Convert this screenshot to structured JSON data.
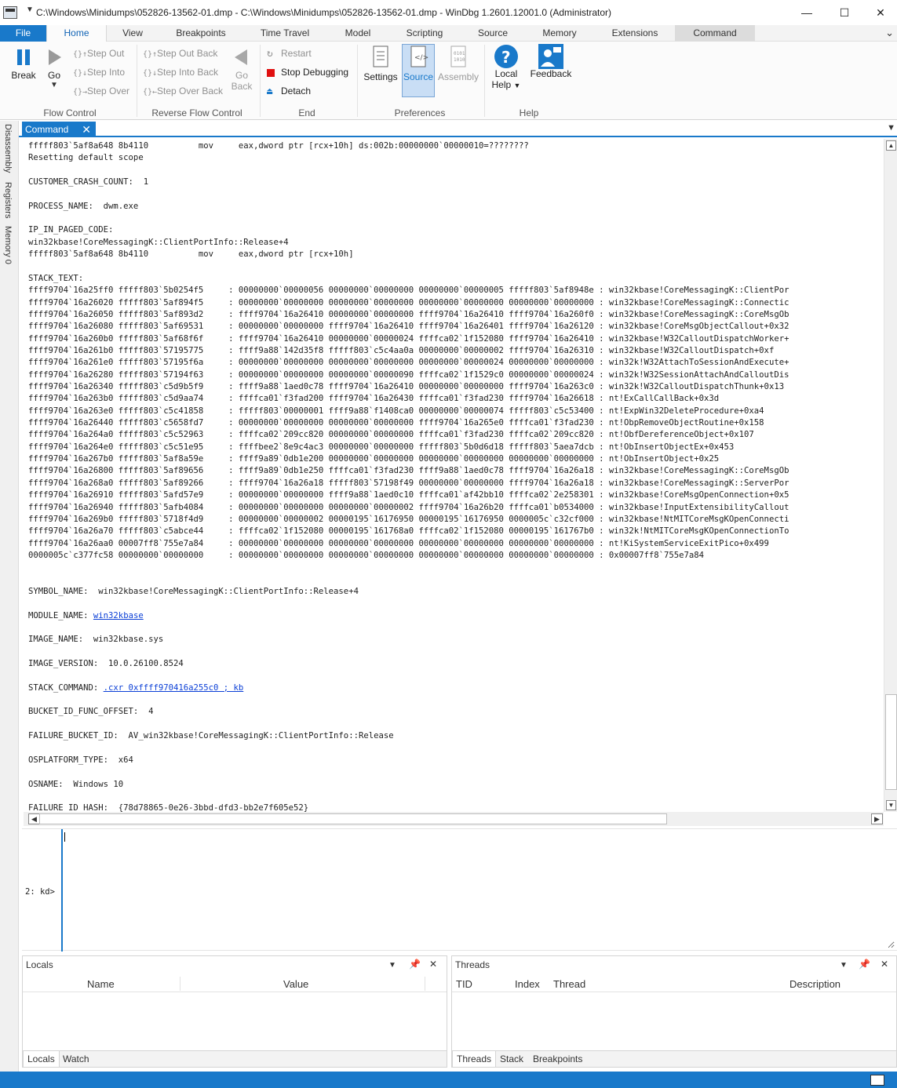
{
  "window": {
    "title": "C:\\Windows\\Minidumps\\052826-13562-01.dmp - C:\\Windows\\Minidumps\\052826-13562-01.dmp - WinDbg 1.2601.12001.0 (Administrator)",
    "minimize": "—",
    "maximize": "☐",
    "close": "✕"
  },
  "tabs": {
    "file": "File",
    "home": "Home",
    "view": "View",
    "breakpoints": "Breakpoints",
    "time_travel": "Time Travel",
    "model": "Model",
    "scripting": "Scripting",
    "source": "Source",
    "memory": "Memory",
    "extensions": "Extensions",
    "command": "Command"
  },
  "ribbon": {
    "flow_control": {
      "label": "Flow Control",
      "break": "Break",
      "go": "Go",
      "step_out": "Step Out",
      "step_into": "Step Into",
      "step_over": "Step Over"
    },
    "reverse_flow_control": {
      "label": "Reverse Flow Control",
      "step_out_back": "Step Out Back",
      "step_into_back": "Step Into Back",
      "step_over_back": "Step Over Back",
      "go_back_1": "Go",
      "go_back_2": "Back"
    },
    "end": {
      "label": "End",
      "restart": "Restart",
      "stop_debugging": "Stop Debugging",
      "detach": "Detach"
    },
    "preferences": {
      "label": "Preferences",
      "settings": "Settings",
      "source": "Source",
      "assembly": "Assembly"
    },
    "help": {
      "label": "Help",
      "local_help_1": "Local",
      "local_help_2": "Help",
      "feedback": "Feedback"
    }
  },
  "side_tabs": [
    "Disassembly",
    "Registers",
    "Memory 0"
  ],
  "command_window": {
    "tab_label": "Command",
    "lines": [
      "fffff803`5af8a648 8b4110          mov     eax,dword ptr [rcx+10h] ds:002b:00000000`00000010=????????",
      "Resetting default scope",
      "",
      "CUSTOMER_CRASH_COUNT:  1",
      "",
      "PROCESS_NAME:  dwm.exe",
      "",
      "IP_IN_PAGED_CODE:",
      "win32kbase!CoreMessagingK::ClientPortInfo::Release+4",
      "fffff803`5af8a648 8b4110          mov     eax,dword ptr [rcx+10h]",
      "",
      "STACK_TEXT:",
      "ffff9704`16a25ff0 fffff803`5b0254f5     : 00000000`00000056 00000000`00000000 00000000`00000005 fffff803`5af8948e : win32kbase!CoreMessagingK::ClientPor",
      "ffff9704`16a26020 fffff803`5af894f5     : 00000000`00000000 00000000`00000000 00000000`00000000 00000000`00000000 : win32kbase!CoreMessagingK::Connectic",
      "ffff9704`16a26050 fffff803`5af893d2     : ffff9704`16a26410 00000000`00000000 ffff9704`16a26410 ffff9704`16a260f0 : win32kbase!CoreMessagingK::CoreMsgOb",
      "ffff9704`16a26080 fffff803`5af69531     : 00000000`00000000 ffff9704`16a26410 ffff9704`16a26401 ffff9704`16a26120 : win32kbase!CoreMsgObjectCallout+0x32",
      "ffff9704`16a260b0 fffff803`5af68f6f     : ffff9704`16a26410 00000000`00000024 ffffca02`1f152080 ffff9704`16a26410 : win32kbase!W32CalloutDispatchWorker+",
      "ffff9704`16a261b0 fffff803`57195775     : ffff9a88`142d35f8 fffff803`c5c4aa0a 00000000`00000002 ffff9704`16a26310 : win32kbase!W32CalloutDispatch+0xf",
      "ffff9704`16a261e0 fffff803`57195f6a     : 00000000`00000000 00000000`00000000 00000000`00000024 00000000`00000000 : win32k!W32AttachToSessionAndExecute+",
      "ffff9704`16a26280 fffff803`57194f63     : 00000000`00000000 00000000`00000090 ffffca02`1f1529c0 00000000`00000024 : win32k!W32SessionAttachAndCalloutDis",
      "ffff9704`16a26340 fffff803`c5d9b5f9     : ffff9a88`1aed0c78 ffff9704`16a26410 00000000`00000000 ffff9704`16a263c0 : win32k!W32CalloutDispatchThunk+0x13",
      "ffff9704`16a263b0 fffff803`c5d9aa74     : ffffca01`f3fad200 ffff9704`16a26430 ffffca01`f3fad230 ffff9704`16a26618 : nt!ExCallCallBack+0x3d",
      "ffff9704`16a263e0 fffff803`c5c41858     : fffff803`00000001 ffff9a88`f1408ca0 00000000`00000074 fffff803`c5c53400 : nt!ExpWin32DeleteProcedure+0xa4",
      "ffff9704`16a26440 fffff803`c5658fd7     : 00000000`00000000 00000000`00000000 ffff9704`16a265e0 ffffca01`f3fad230 : nt!ObpRemoveObjectRoutine+0x158",
      "ffff9704`16a264a0 fffff803`c5c52963     : ffffca02`209cc820 00000000`00000000 ffffca01`f3fad230 ffffca02`209cc820 : nt!ObfDereferenceObject+0x107",
      "ffff9704`16a264e0 fffff803`c5c51e95     : ffffbee2`8e9c4ac3 00000000`00000000 fffff803`5b0d6d18 fffff803`5aea7dcb : nt!ObInsertObjectEx+0x453",
      "ffff9704`16a267b0 fffff803`5af8a59e     : ffff9a89`0db1e200 00000000`00000000 00000000`00000000 00000000`00000000 : nt!ObInsertObject+0x25",
      "ffff9704`16a26800 fffff803`5af89656     : ffff9a89`0db1e250 ffffca01`f3fad230 ffff9a88`1aed0c78 ffff9704`16a26a18 : win32kbase!CoreMessagingK::CoreMsgOb",
      "ffff9704`16a268a0 fffff803`5af89266     : ffff9704`16a26a18 fffff803`57198f49 00000000`00000000 ffff9704`16a26a18 : win32kbase!CoreMessagingK::ServerPor",
      "ffff9704`16a26910 fffff803`5afd57e9     : 00000000`00000000 ffff9a88`1aed0c10 ffffca01`af42bb10 ffffca02`2e258301 : win32kbase!CoreMsgOpenConnection+0x5",
      "ffff9704`16a26940 fffff803`5afb4084     : 00000000`00000000 00000000`00000002 ffff9704`16a26b20 ffffca01`b0534000 : win32kbase!InputExtensibilityCallout",
      "ffff9704`16a269b0 fffff803`5718f4d9     : 00000000`00000002 00000195`16176950 00000195`16176950 0000005c`c32cf000 : win32kbase!NtMITCoreMsgKOpenConnecti",
      "ffff9704`16a26a70 fffff803`c5abce44     : ffffca02`1f152080 00000195`161768a0 ffffca02`1f152080 00000195`161767b0 : win32k!NtMITCoreMsgKOpenConnectionTo",
      "ffff9704`16a26aa0 00007ff8`755e7a84     : 00000000`00000000 00000000`00000000 00000000`00000000 00000000`00000000 : nt!KiSystemServiceExitPico+0x499",
      "0000005c`c377fc58 00000000`00000000     : 00000000`00000000 00000000`00000000 00000000`00000000 00000000`00000000 : 0x00007ff8`755e7a84",
      "",
      "",
      "SYMBOL_NAME:  win32kbase!CoreMessagingK::ClientPortInfo::Release+4",
      ""
    ],
    "module_label": "MODULE_NAME: ",
    "module_link": "win32kbase",
    "after_module": [
      "",
      "IMAGE_NAME:  win32kbase.sys",
      "",
      "IMAGE_VERSION:  10.0.26100.8524",
      ""
    ],
    "stack_command_label": "STACK_COMMAND: ",
    "stack_command_link": ".cxr 0xffff970416a255c0 ; kb",
    "after_stack_command": [
      "",
      "BUCKET_ID_FUNC_OFFSET:  4",
      "",
      "FAILURE_BUCKET_ID:  AV_win32kbase!CoreMessagingK::ClientPortInfo::Release",
      "",
      "OSPLATFORM_TYPE:  x64",
      "",
      "OSNAME:  Windows 10",
      "",
      "FAILURE_ID_HASH:  {78d78865-0e26-3bbd-dfd3-bb2e7f605e52}"
    ],
    "prompt": "2: kd>",
    "input_value": ""
  },
  "locals_pane": {
    "title": "Locals",
    "columns": [
      "Name",
      "Value"
    ],
    "tabs": [
      "Locals",
      "Watch"
    ]
  },
  "threads_pane": {
    "title": "Threads",
    "columns": [
      "TID",
      "Index",
      "Thread",
      "Description"
    ],
    "tabs": [
      "Threads",
      "Stack",
      "Breakpoints"
    ]
  },
  "colors": {
    "accent": "#1979ca",
    "link": "#0b3fd6",
    "stop_red": "#e01010"
  }
}
